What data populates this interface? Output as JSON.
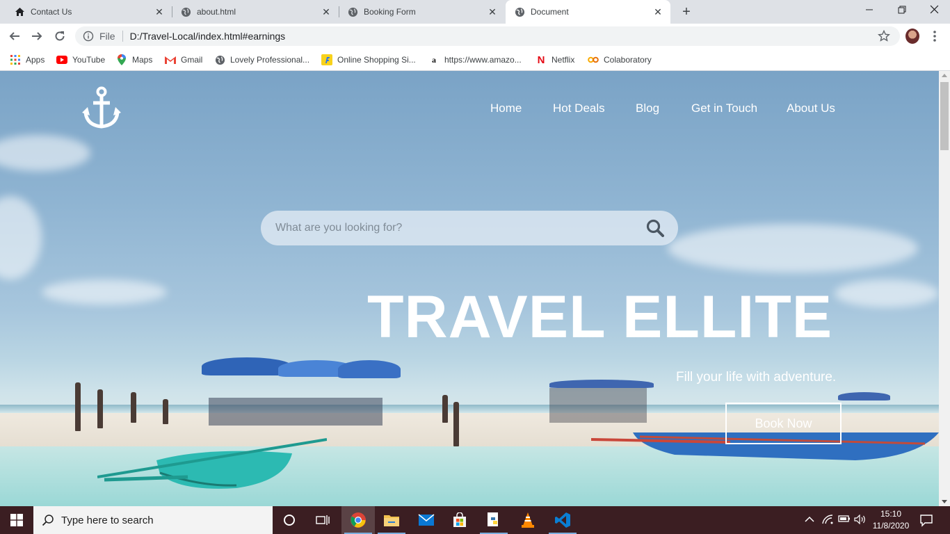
{
  "browser": {
    "tabs": [
      {
        "title": "Contact Us",
        "icon": "home-icon"
      },
      {
        "title": "about.html",
        "icon": "globe-icon"
      },
      {
        "title": "Booking Form",
        "icon": "globe-icon"
      },
      {
        "title": "Document",
        "icon": "globe-icon",
        "active": true
      }
    ],
    "address": {
      "scheme_label": "File",
      "url": "D:/Travel-Local/index.html#earnings"
    },
    "bookmarks": [
      {
        "label": "Apps",
        "icon": "apps-grid-icon"
      },
      {
        "label": "YouTube",
        "icon": "youtube-icon"
      },
      {
        "label": "Maps",
        "icon": "maps-icon"
      },
      {
        "label": "Gmail",
        "icon": "gmail-icon"
      },
      {
        "label": "Lovely Professional...",
        "icon": "globe-icon"
      },
      {
        "label": "Online Shopping Si...",
        "icon": "flipkart-icon"
      },
      {
        "label": "https://www.amazo...",
        "icon": "amazon-icon"
      },
      {
        "label": "Netflix",
        "icon": "netflix-icon"
      },
      {
        "label": "Colaboratory",
        "icon": "colab-icon"
      }
    ]
  },
  "page": {
    "nav": [
      "Home",
      "Hot Deals",
      "Blog",
      "Get in Touch",
      "About Us"
    ],
    "search": {
      "placeholder": "What are you looking for?"
    },
    "hero": {
      "title": "TRAVEL ELLITE",
      "tagline": "Fill your life with adventure.",
      "cta": "Book Now"
    },
    "colors": {
      "accent": "#ffffff",
      "sky": "#8fb4d2",
      "sea": "#9fd6d5"
    }
  },
  "taskbar": {
    "search_placeholder": "Type here to search",
    "time": "15:10",
    "date": "11/8/2020"
  }
}
